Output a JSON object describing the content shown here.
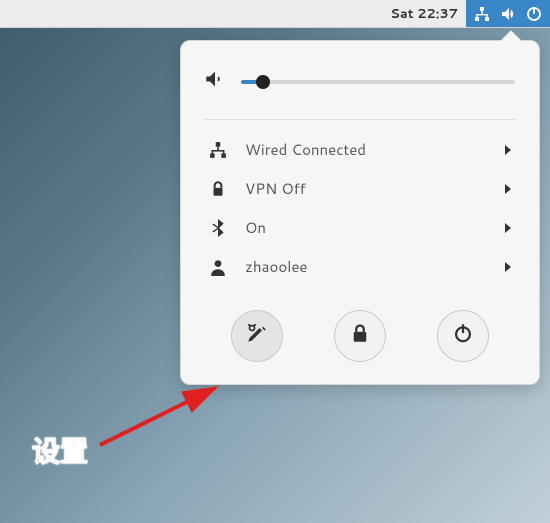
{
  "topbar": {
    "clock": "Sat 22:37"
  },
  "volume": {
    "percent": 8
  },
  "menu": {
    "network_label": "Wired Connected",
    "vpn_label": "VPN Off",
    "bluetooth_label": "On",
    "user_label": "zhaoolee"
  },
  "annotation": {
    "label": "设置"
  }
}
